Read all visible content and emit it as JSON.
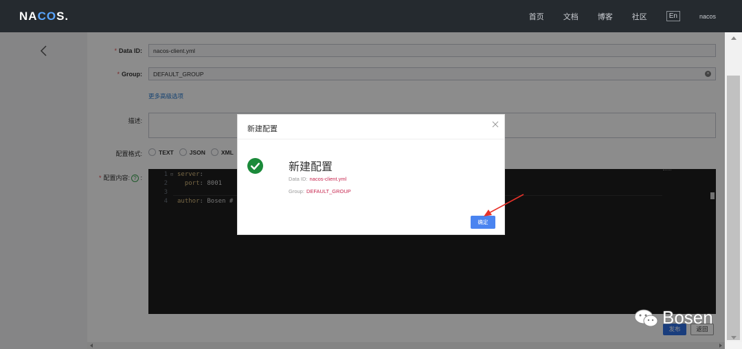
{
  "topbar": {
    "logo_left": "NA",
    "logo_mid": "CO",
    "logo_right": "S.",
    "nav": [
      "首页",
      "文档",
      "博客",
      "社区"
    ],
    "lang": "En",
    "user": "nacos"
  },
  "form": {
    "data_id_label": "Data ID:",
    "data_id_value": "nacos-client.yml",
    "group_label": "Group:",
    "group_value": "DEFAULT_GROUP",
    "more_options": "更多高级选项",
    "desc_label": "描述:",
    "format_label": "配置格式:",
    "formats": [
      "TEXT",
      "JSON",
      "XML"
    ],
    "content_label": "配置内容:",
    "content_suffix": ":",
    "help_glyph": "?"
  },
  "editor": {
    "lines": [
      {
        "num": "1",
        "fold": "⊟",
        "key": "server",
        "rest": ":"
      },
      {
        "num": "2",
        "fold": "",
        "key": "  port",
        "rest": ": 8001"
      },
      {
        "num": "3",
        "fold": "",
        "key": "",
        "rest": ""
      },
      {
        "num": "4",
        "fold": "",
        "key": "author",
        "rest": ": Bosen #"
      }
    ]
  },
  "actions": {
    "publish": "发布",
    "back": "返回"
  },
  "dialog": {
    "title": "新建配置",
    "heading": "新建配置",
    "data_id_label": "Data ID:",
    "data_id_value": "nacos-client.yml",
    "group_label": "Group:",
    "group_value": "DEFAULT_GROUP",
    "ok": "确定"
  },
  "watermark": {
    "text": "Bosen"
  },
  "colors": {
    "topbar": "#252a2f",
    "primary": "#2f6fe4",
    "success": "#1b8a3a",
    "required": "#e0464a",
    "arrow": "#e8322a"
  }
}
